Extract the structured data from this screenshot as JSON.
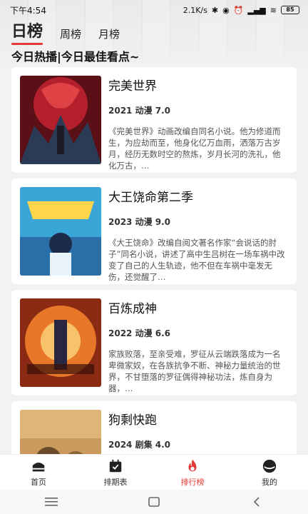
{
  "status_bar": {
    "time": "下午4:54",
    "speed": "2.1K/s",
    "battery": "85"
  },
  "tabs": [
    {
      "label": "日榜",
      "active": true
    },
    {
      "label": "周榜",
      "active": false
    },
    {
      "label": "月榜",
      "active": false
    }
  ],
  "subtitle": "今日热播|今日最佳看点~",
  "items": [
    {
      "title": "完美世界",
      "meta": "2021 动漫 7.0",
      "description": "《完美世界》动画改编自同名小说。他为修道而生，为应劫而至，他身化亿万血雨，洒落万古岁月，经历无数时空的熬炼，岁月长河的洗礼，他化万古，…"
    },
    {
      "title": "大王饶命第二季",
      "meta": "2023 动漫 9.0",
      "description": "《大王饶命》改编自阅文著名作家“会说话的肘子”同名小说，讲述了高中生吕树在一场车祸中改变了自己的人生轨迹，他不但在车祸中毫发无伤，还觉醒了…"
    },
    {
      "title": "百炼成神",
      "meta": "2022 动漫 6.6",
      "description": "家族败落，至亲受难，罗征从云端跌落成为一名卑微家奴，在各族抗争不断、神秘力量统治的世界，不甘堕落的罗征偶得神秘功法，炼自身为器，…"
    },
    {
      "title": "狗剩快跑",
      "meta": "2024 剧集 4.0",
      "description": ""
    }
  ],
  "bottom_nav": [
    {
      "label": "首页",
      "icon": "home-icon",
      "active": false
    },
    {
      "label": "排期表",
      "icon": "calendar-icon",
      "active": false
    },
    {
      "label": "排行榜",
      "icon": "fire-icon",
      "active": true
    },
    {
      "label": "我的",
      "icon": "profile-icon",
      "active": false
    }
  ],
  "colors": {
    "accent": "#e53935",
    "card_bg": "#ffffff",
    "page_bg": "#f2f2f2"
  }
}
